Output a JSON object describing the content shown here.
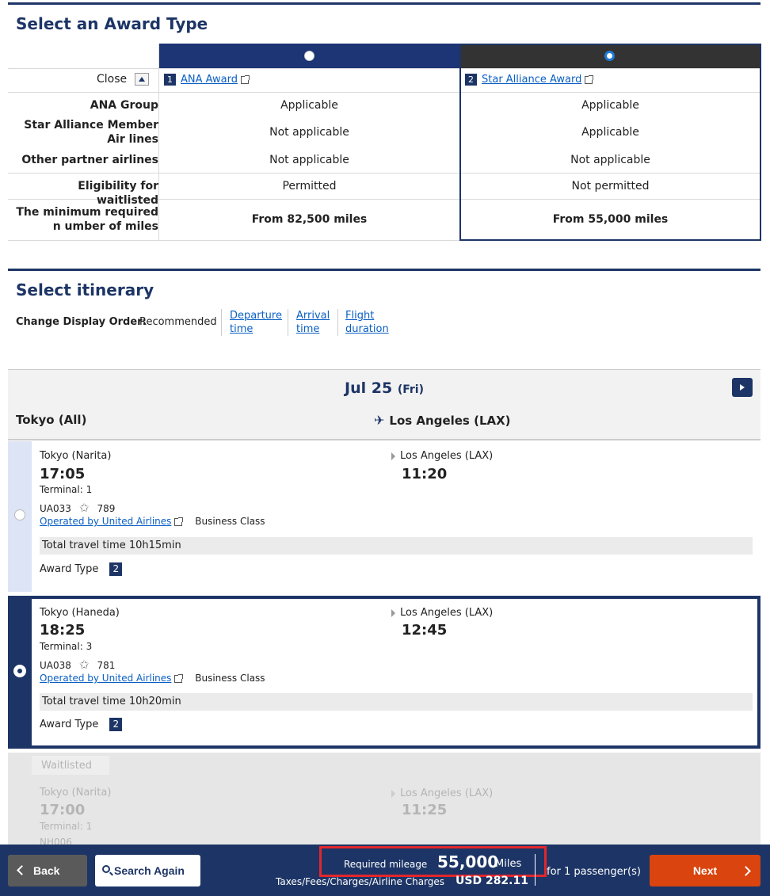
{
  "award_section": {
    "title": "Select an Award Type",
    "close_label": "Close",
    "award1": {
      "num": "1",
      "label": "ANA Award"
    },
    "award2": {
      "num": "2",
      "label": "Star Alliance Award"
    },
    "rows": [
      {
        "label": "ANA Group",
        "a1": "Applicable",
        "a2": "Applicable"
      },
      {
        "label": "Star Alliance Member Air lines",
        "a1": "Not applicable",
        "a2": "Applicable"
      },
      {
        "label": "Other partner airlines",
        "a1": "Not applicable",
        "a2": "Not applicable"
      },
      {
        "label": "Eligibility for waitlisted",
        "a1": "Permitted",
        "a2": "Not permitted"
      },
      {
        "label": "The minimum required n umber of miles",
        "a1": "From 82,500 miles",
        "a2": "From 55,000 miles"
      }
    ]
  },
  "itinerary": {
    "title": "Select itinerary",
    "order_label": "Change Display Order:",
    "order_current": "Recommended",
    "order_options": [
      "Departure time",
      "Arrival time",
      "Flight duration"
    ],
    "date": "Jul 25",
    "day": "(Fri)",
    "from": "Tokyo (All)",
    "to": "Los Angeles (LAX)"
  },
  "flights": [
    {
      "dep_city": "Tokyo (Narita)",
      "dep_time": "17:05",
      "terminal": "Terminal: 1",
      "flight_no": "UA033",
      "aircraft": "789",
      "operator": "Operated by United Airlines",
      "cabin": "Business Class",
      "arr_city": "Los Angeles (LAX)",
      "arr_time": "11:20",
      "total_time": "Total travel time 10h15min",
      "award_type_label": "Award Type",
      "award_type": "2"
    },
    {
      "dep_city": "Tokyo (Haneda)",
      "dep_time": "18:25",
      "terminal": "Terminal: 3",
      "flight_no": "UA038",
      "aircraft": "781",
      "operator": "Operated by United Airlines",
      "cabin": "Business Class",
      "arr_city": "Los Angeles (LAX)",
      "arr_time": "12:45",
      "total_time": "Total travel time 10h20min",
      "award_type_label": "Award Type",
      "award_type": "2"
    },
    {
      "status": "Waitlisted",
      "dep_city": "Tokyo (Narita)",
      "dep_time": "17:00",
      "terminal": "Terminal: 1",
      "flight_no": "NH006",
      "arr_city": "Los Angeles (LAX)",
      "arr_time": "11:25"
    }
  ],
  "footer": {
    "back": "Back",
    "search_again": "Search Again",
    "required_label": "Required mileage",
    "required_miles": "55,000",
    "miles_unit": "Miles",
    "passengers": "for 1 passenger(s)",
    "taxes_label": "Taxes/Fees/Charges/Airline Charges",
    "taxes_value": "USD  282.11",
    "next": "Next"
  },
  "colors": {
    "navy": "#1d3566",
    "award1_header": "#1d3475",
    "highlight": "#e3262b",
    "next_button": "#d9440f"
  }
}
